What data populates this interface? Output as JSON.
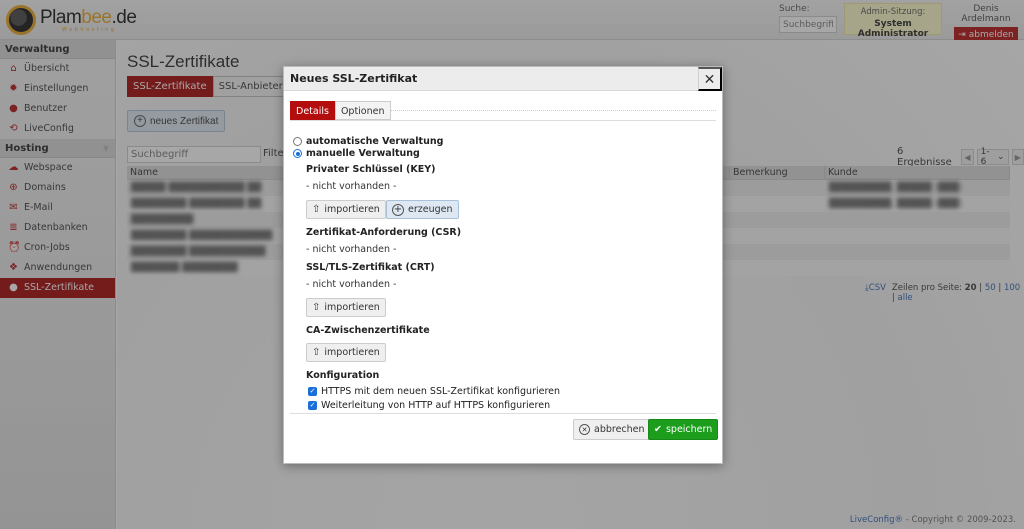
{
  "header": {
    "logo": {
      "name_main": "Plam",
      "name_accent": "bee",
      "name_tld": ".de",
      "tagline": "Webhosting"
    },
    "search": {
      "label": "Suche:",
      "placeholder": "Suchbegriff"
    },
    "admin_session": {
      "label": "Admin-Sitzung:",
      "role": "System Administrator"
    },
    "user": {
      "name": "Denis Ardelmann",
      "logout_label": "abmelden"
    }
  },
  "sidebar": {
    "sections": [
      {
        "title": "Verwaltung",
        "items": [
          {
            "label": "Übersicht",
            "icon": "home-icon",
            "glyph": "⌂"
          },
          {
            "label": "Einstellungen",
            "icon": "gear-icon",
            "glyph": "✹"
          },
          {
            "label": "Benutzer",
            "icon": "user-icon",
            "glyph": "●"
          },
          {
            "label": "LiveConfig",
            "icon": "refresh-icon",
            "glyph": "⟲"
          }
        ]
      },
      {
        "title": "Hosting",
        "items": [
          {
            "label": "Webspace",
            "icon": "cloud-icon",
            "glyph": "☁"
          },
          {
            "label": "Domains",
            "icon": "globe-icon",
            "glyph": "⊕"
          },
          {
            "label": "E-Mail",
            "icon": "envelope-icon",
            "glyph": "✉"
          },
          {
            "label": "Datenbanken",
            "icon": "database-icon",
            "glyph": "≣"
          },
          {
            "label": "Cron-Jobs",
            "icon": "alarm-clock-icon",
            "glyph": "⏰"
          },
          {
            "label": "Anwendungen",
            "icon": "cube-icon",
            "glyph": "❖"
          },
          {
            "label": "SSL-Zertifikate",
            "icon": "lock-icon",
            "glyph": "🔒",
            "active": true
          }
        ]
      }
    ]
  },
  "main": {
    "title": "SSL-Zertifikate",
    "tabs": [
      {
        "label": "SSL-Zertifikate",
        "active": true
      },
      {
        "label": "SSL-Anbieter",
        "active": false
      }
    ],
    "new_button": "neues Zertifikat",
    "filter": {
      "placeholder": "Suchbegriff",
      "label": "Filte"
    },
    "results": {
      "count": "6 Ergebnisse",
      "range": "1-6"
    },
    "table": {
      "columns": [
        "Name",
        "Bemerkung",
        "Kunde"
      ],
      "rows": [
        {
          "name": "█████ ███████████ ██",
          "bemerkung": "",
          "kunde": "█████████, █████ (███)"
        },
        {
          "name": "████████ ████████ ██",
          "bemerkung": "",
          "kunde": "█████████, █████ (███)"
        },
        {
          "name": "█████████",
          "bemerkung": "",
          "kunde": ""
        },
        {
          "name": "████████ ████████████",
          "bemerkung": "",
          "kunde": ""
        },
        {
          "name": "████████ ███████████",
          "bemerkung": "",
          "kunde": ""
        },
        {
          "name": "███████ ████████",
          "bemerkung": "",
          "kunde": ""
        }
      ]
    },
    "footer_controls": {
      "csv": "CSV",
      "rows_label": "Zeilen pro Seite:",
      "options": [
        "20",
        "50",
        "100",
        "alle"
      ],
      "selected": "20"
    }
  },
  "footer": {
    "brand": "LiveConfig®",
    "copyright": " - Copyright © 2009-2023."
  },
  "modal": {
    "title": "Neues SSL-Zertifikat",
    "tabs": [
      {
        "label": "Details",
        "active": true
      },
      {
        "label": "Optionen",
        "active": false
      }
    ],
    "mode_options": [
      {
        "label": "automatische Verwaltung",
        "selected": false
      },
      {
        "label": "manuelle Verwaltung",
        "selected": true
      }
    ],
    "private_key": {
      "title": "Privater Schlüssel (KEY)",
      "status": "- nicht vorhanden -",
      "import_label": "importieren",
      "generate_label": "erzeugen"
    },
    "csr": {
      "title": "Zertifikat-Anforderung (CSR)",
      "status": "- nicht vorhanden -"
    },
    "crt": {
      "title": "SSL/TLS-Zertifikat (CRT)",
      "status": "- nicht vorhanden -",
      "import_label": "importieren"
    },
    "ca": {
      "title": "CA-Zwischenzertifikate",
      "import_label": "importieren"
    },
    "config": {
      "title": "Konfiguration",
      "options": [
        {
          "label": "HTTPS mit dem neuen SSL-Zertifikat konfigurieren",
          "checked": true
        },
        {
          "label": "Weiterleitung von HTTP auf HTTPS konfigurieren",
          "checked": true
        }
      ]
    },
    "cancel_label": "abbrechen",
    "save_label": "speichern"
  }
}
